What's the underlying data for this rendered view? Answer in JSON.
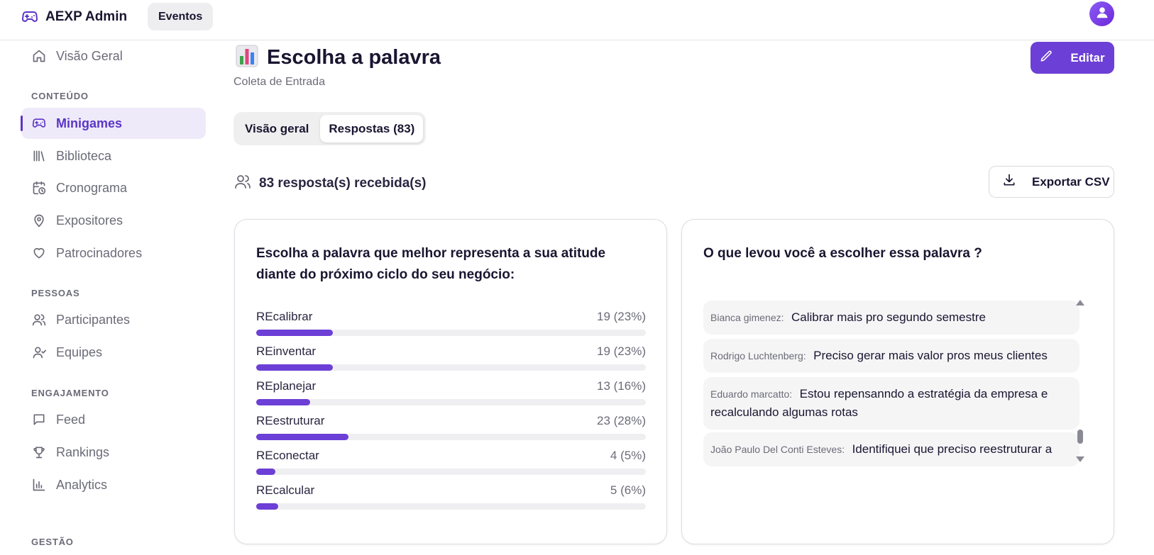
{
  "app": {
    "name": "AEXP Admin",
    "nav_pill": "Eventos"
  },
  "sidebar": {
    "top_item": {
      "label": "Visão Geral",
      "icon": "home-icon"
    },
    "sections": [
      {
        "title": "CONTEÚDO",
        "items": [
          {
            "label": "Minigames",
            "icon": "gamepad-icon",
            "active": true
          },
          {
            "label": "Biblioteca",
            "icon": "library-icon"
          },
          {
            "label": "Cronograma",
            "icon": "calendar-clock-icon"
          },
          {
            "label": "Expositores",
            "icon": "map-pin-icon"
          },
          {
            "label": "Patrocinadores",
            "icon": "heart-icon"
          }
        ]
      },
      {
        "title": "PESSOAS",
        "items": [
          {
            "label": "Participantes",
            "icon": "users-icon"
          },
          {
            "label": "Equipes",
            "icon": "team-icon"
          }
        ]
      },
      {
        "title": "ENGAJAMENTO",
        "items": [
          {
            "label": "Feed",
            "icon": "message-square-icon"
          },
          {
            "label": "Rankings",
            "icon": "trophy-icon"
          },
          {
            "label": "Analytics",
            "icon": "bar-chart-icon"
          }
        ]
      },
      {
        "title": "GESTÃO",
        "items": []
      }
    ]
  },
  "page": {
    "title": "Escolha a palavra",
    "title_icon": "bar-chart-emoji-icon",
    "subtitle": "Coleta de Entrada",
    "edit_label": "Editar"
  },
  "tabs": [
    {
      "label": "Visão geral",
      "active": false
    },
    {
      "label": "Respostas (83)",
      "active": true
    }
  ],
  "responses_summary": {
    "text": "83 resposta(s) recebida(s)",
    "export_label": "Exportar CSV"
  },
  "question_left": {
    "text": "Escolha a palavra que melhor representa a sua atitude diante do próximo ciclo do seu negócio:",
    "options": [
      {
        "label": "REcalibrar",
        "count": 19,
        "percent": 23,
        "display": "19 (23%)"
      },
      {
        "label": "REinventar",
        "count": 19,
        "percent": 23,
        "display": "19 (23%)"
      },
      {
        "label": "REplanejar",
        "count": 13,
        "percent": 16,
        "display": "13 (16%)"
      },
      {
        "label": "REestruturar",
        "count": 23,
        "percent": 28,
        "display": "23 (28%)"
      },
      {
        "label": "REconectar",
        "count": 4,
        "percent": 5,
        "display": "4 (5%)"
      },
      {
        "label": "REcalcular",
        "count": 5,
        "percent": 6,
        "display": "5 (6%)"
      }
    ]
  },
  "question_right": {
    "text": "O que levou você a escolher essa palavra ?",
    "answers": [
      {
        "name": "Bianca gimenez:",
        "text": "Calibrar mais pro segundo semestre"
      },
      {
        "name": "Rodrigo Luchtenberg:",
        "text": "Preciso gerar mais valor pros meus clientes"
      },
      {
        "name": "Eduardo marcatto:",
        "text": "Estou repensanndo a estratégia da empresa e recalculando algumas rotas"
      },
      {
        "name": "João Paulo Del Conti Esteves:",
        "text": "Identifiquei que preciso reestruturar a"
      }
    ]
  },
  "colors": {
    "accent": "#6c3fd6",
    "active_bg": "#efeaf9",
    "track": "#efeff2"
  }
}
